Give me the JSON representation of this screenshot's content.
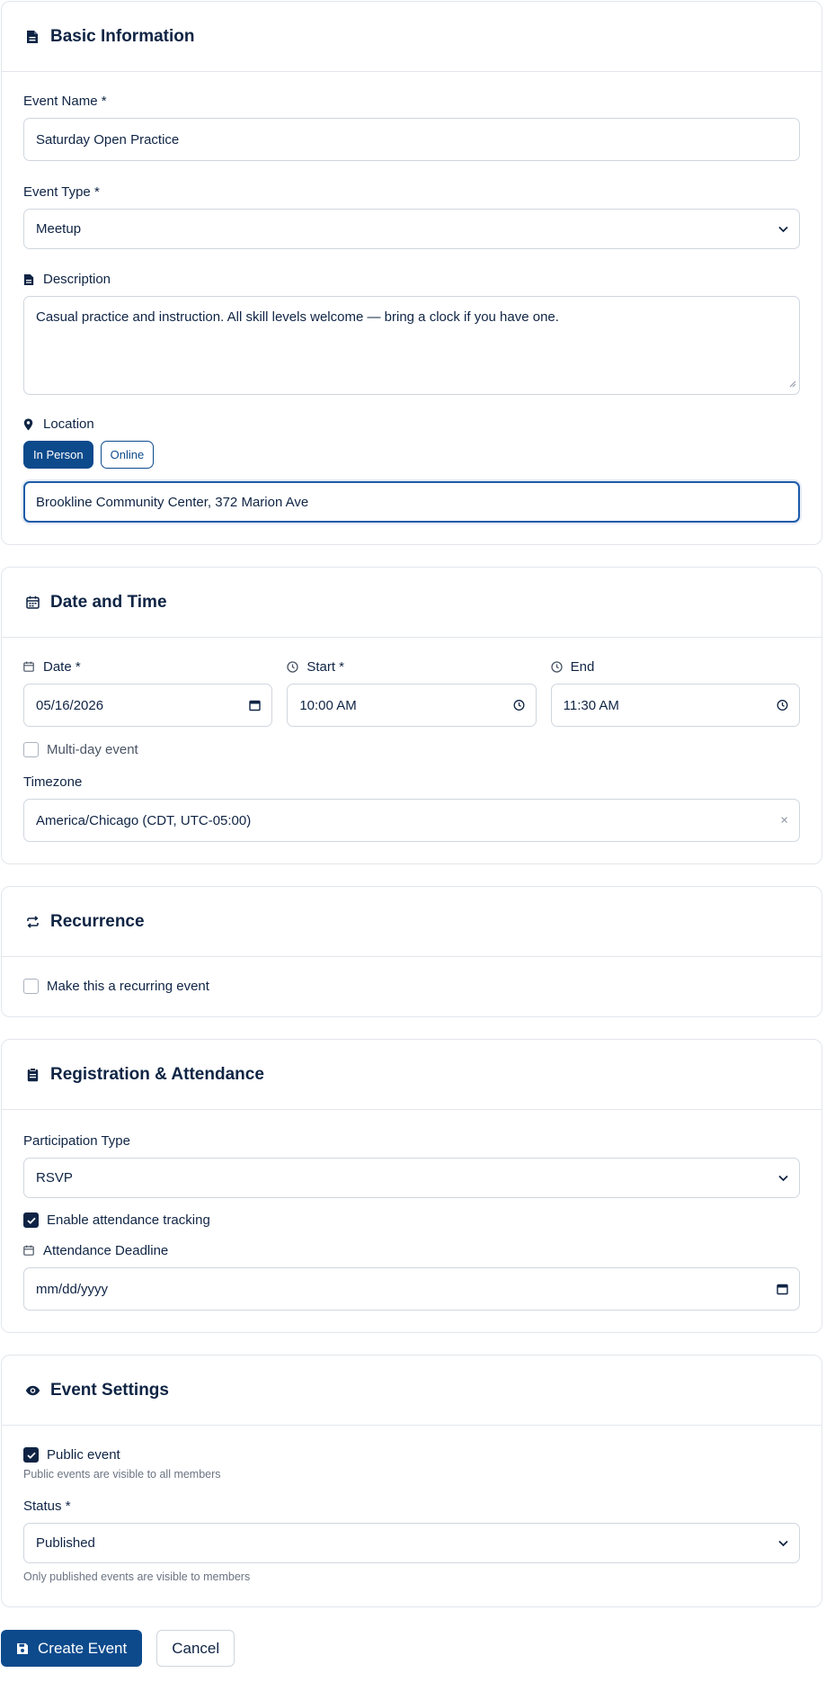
{
  "colors": {
    "primary": "#0d4a8c",
    "text": "#0f2444",
    "border": "#d0d6df",
    "focus": "#1d5ba8"
  },
  "basic": {
    "title": "Basic Information",
    "event_name_label": "Event Name *",
    "event_name_value": "Saturday Open Practice",
    "event_type_label": "Event Type *",
    "event_type_value": "Meetup",
    "description_label": "Description",
    "description_value": "Casual practice and instruction. All skill levels welcome — bring a clock if you have one.",
    "location_label": "Location",
    "location_in_person": "In Person",
    "location_online": "Online",
    "location_value": "Brookline Community Center, 372 Marion Ave"
  },
  "datetime": {
    "title": "Date and Time",
    "date_label": "Date *",
    "date_value": "05/16/2026",
    "start_label": "Start *",
    "start_value": "10:00 AM",
    "end_label": "End",
    "end_value": "11:30 AM",
    "multiday_label": "Multi-day event",
    "timezone_label": "Timezone",
    "timezone_value": "America/Chicago (CDT, UTC-05:00)",
    "clear_symbol": "×"
  },
  "recurrence": {
    "title": "Recurrence",
    "recurring_label": "Make this a recurring event"
  },
  "registration": {
    "title": "Registration & Attendance",
    "participation_label": "Participation Type",
    "participation_value": "RSVP",
    "tracking_label": "Enable attendance tracking",
    "deadline_label": "Attendance Deadline",
    "deadline_placeholder": "mm/dd/yyyy"
  },
  "settings": {
    "title": "Event Settings",
    "public_label": "Public event",
    "public_hint": "Public events are visible to all members",
    "status_label": "Status *",
    "status_value": "Published",
    "status_hint": "Only published events are visible to members"
  },
  "actions": {
    "create_label": "Create Event",
    "cancel_label": "Cancel"
  },
  "icons": {
    "basic": "document-icon",
    "calendar": "calendar-icon",
    "clock": "clock-icon",
    "location": "map-pin-icon",
    "recurrence": "repeat-icon",
    "registration": "clipboard-icon",
    "settings": "eye-icon",
    "save": "floppy-disk-icon"
  }
}
